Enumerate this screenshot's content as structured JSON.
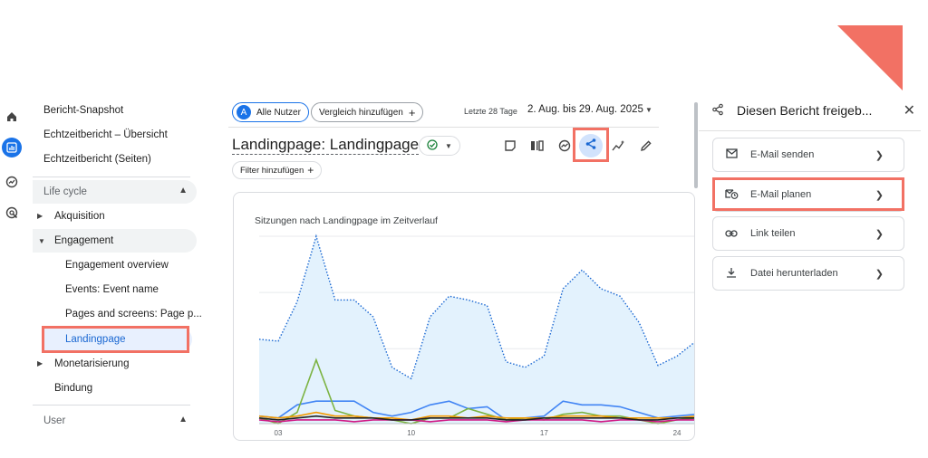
{
  "sidebar": {
    "items": [
      {
        "label": "Bericht-Snapshot"
      },
      {
        "label": "Echtzeitbericht – Übersicht"
      },
      {
        "label": "Echtzeitbericht (Seiten)"
      },
      {
        "label": "Life cycle"
      },
      {
        "label": "Akquisition"
      },
      {
        "label": "Engagement"
      },
      {
        "label": "Engagement overview"
      },
      {
        "label": "Events: Event name"
      },
      {
        "label": "Pages and screens: Page p..."
      },
      {
        "label": "Landingpage"
      },
      {
        "label": "Monetarisierung"
      },
      {
        "label": "Bindung"
      },
      {
        "label": "User"
      }
    ]
  },
  "rail": {
    "icons": [
      "home-icon",
      "reports-icon",
      "explore-icon",
      "advertising-icon"
    ]
  },
  "header": {
    "segment_avatar": "A",
    "segment_label": "Alle Nutzer",
    "compare_label": "Vergleich hinzufügen",
    "date_range_label": "Letzte 28 Tage",
    "date_range_value": "2. Aug. bis 29. Aug. 2025",
    "title": "Landingpage: Landingpage",
    "filter_label": "Filter hinzufügen"
  },
  "chart_data": {
    "type": "line",
    "title": "Sitzungen nach Landingpage im Zeitverlauf",
    "x": [
      "02",
      "03",
      "04",
      "05",
      "06",
      "07",
      "08",
      "09",
      "10",
      "11",
      "12",
      "13",
      "14",
      "15",
      "16",
      "17",
      "18",
      "19",
      "20",
      "21",
      "22",
      "23",
      "24",
      "25"
    ],
    "xticks": [
      "03",
      "10",
      "17",
      "24"
    ],
    "ylim": [
      0,
      100
    ],
    "grid": true,
    "series": [
      {
        "color": "#1967d2",
        "style": "dotted-area",
        "values": [
          45,
          44,
          65,
          100,
          66,
          66,
          57,
          30,
          24,
          57,
          68,
          66,
          63,
          33,
          30,
          36,
          72,
          82,
          72,
          68,
          54,
          31,
          36,
          44
        ]
      },
      {
        "color": "#4285f4",
        "values": [
          4,
          3,
          10,
          12,
          12,
          12,
          6,
          4,
          6,
          10,
          12,
          8,
          9,
          2,
          3,
          4,
          12,
          10,
          10,
          9,
          6,
          3,
          4,
          5
        ]
      },
      {
        "color": "#7cb342",
        "values": [
          3,
          0,
          6,
          34,
          7,
          4,
          3,
          2,
          0,
          3,
          3,
          8,
          5,
          2,
          3,
          2,
          5,
          6,
          4,
          4,
          2,
          0,
          2,
          3
        ]
      },
      {
        "color": "#f29900",
        "values": [
          4,
          3,
          4,
          6,
          4,
          4,
          3,
          3,
          2,
          4,
          4,
          3,
          4,
          3,
          3,
          3,
          4,
          4,
          4,
          3,
          3,
          3,
          3,
          4
        ]
      },
      {
        "color": "#d01884",
        "values": [
          2,
          1,
          2,
          2,
          2,
          1,
          2,
          2,
          2,
          1,
          2,
          2,
          2,
          1,
          2,
          2,
          2,
          2,
          1,
          2,
          2,
          1,
          2,
          2
        ]
      },
      {
        "color": "#202124",
        "values": [
          3,
          2,
          3,
          4,
          3,
          3,
          3,
          2,
          2,
          3,
          3,
          3,
          3,
          2,
          2,
          3,
          3,
          3,
          3,
          3,
          2,
          2,
          3,
          3
        ]
      }
    ]
  },
  "share_panel": {
    "title": "Diesen Bericht freigeb...",
    "options": [
      {
        "label": "E-Mail senden",
        "icon": "mail-icon"
      },
      {
        "label": "E-Mail planen",
        "icon": "schedule-mail-icon"
      },
      {
        "label": "Link teilen",
        "icon": "link-icon"
      },
      {
        "label": "Datei herunterladen",
        "icon": "download-icon"
      }
    ]
  },
  "colors": {
    "accent": "#1a73e8",
    "highlight": "#f27164",
    "selected_bg": "#e8f0fe"
  }
}
